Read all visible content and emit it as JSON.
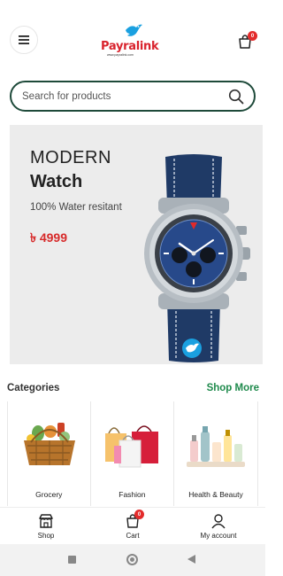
{
  "header": {
    "logo_text": "Payralink",
    "logo_tagline": "www.payralink.com",
    "cart_count": "0"
  },
  "search": {
    "placeholder": "Search for products",
    "value": ""
  },
  "banner": {
    "title": "MODERN",
    "subtitle": "Watch",
    "description": "100% Water resitant",
    "price": "৳ 4999"
  },
  "categories": {
    "title": "Categories",
    "shop_more": "Shop More",
    "items": [
      {
        "label": "Grocery"
      },
      {
        "label": "Fashion"
      },
      {
        "label": "Health & Beauty"
      }
    ]
  },
  "bottom_nav": {
    "shop": "Shop",
    "cart": "Cart",
    "cart_count": "0",
    "account": "My account"
  },
  "colors": {
    "accent_green": "#1f8a4c",
    "price_red": "#d72a2a",
    "search_border": "#1e4a3a"
  }
}
